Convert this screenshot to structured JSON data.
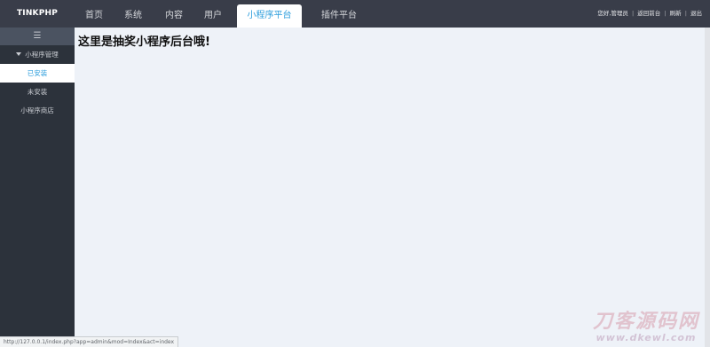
{
  "header": {
    "logo": "TINKPHP",
    "nav": [
      {
        "label": "首页"
      },
      {
        "label": "系统"
      },
      {
        "label": "内容"
      },
      {
        "label": "用户"
      },
      {
        "label": "小程序平台"
      },
      {
        "label": "插件平台"
      }
    ],
    "active_nav": "小程序平台",
    "greeting": "您好,管理员",
    "links": [
      "返回前台",
      "刷新",
      "退出"
    ]
  },
  "sidebar": {
    "collapse_icon": "hamburger-icon",
    "group_label": "小程序管理",
    "sub_items": [
      {
        "label": "已安装",
        "active": true
      },
      {
        "label": "未安装",
        "active": false
      }
    ],
    "store_label": "小程序商店"
  },
  "main": {
    "heading": "这里是抽奖小程序后台哦!"
  },
  "statusbar": {
    "url": "http://127.0.0.1/index.php?app=admin&mod=Index&act=index"
  },
  "watermark": {
    "title": "刀客源码网",
    "url": "www.dkewl.com"
  },
  "colors": {
    "topbar": "#393d49",
    "sidebar": "#2c323b",
    "accent": "#2b9ddc",
    "content_bg": "#eef2f8"
  }
}
